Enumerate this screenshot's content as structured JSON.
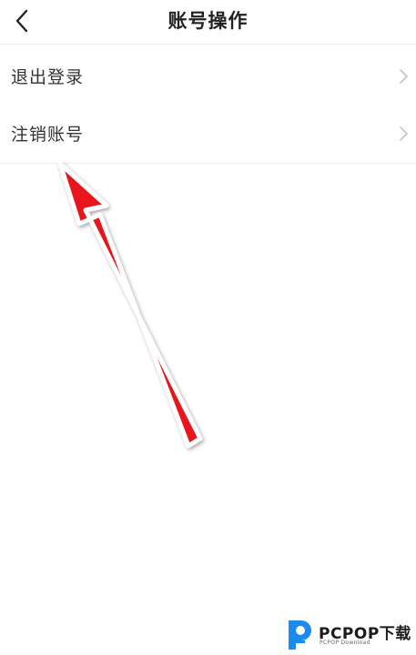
{
  "header": {
    "title": "账号操作",
    "back_icon": "chevron-left-icon"
  },
  "menu": {
    "items": [
      {
        "label": "退出登录",
        "icon": "chevron-right-icon"
      },
      {
        "label": "注销账号",
        "icon": "chevron-right-icon"
      }
    ]
  },
  "annotation": {
    "type": "red-arrow",
    "color": "#e8141b",
    "points_to": "注销账号"
  },
  "watermark": {
    "brand": "PCPOP下载",
    "subtitle": "PCPOP Download",
    "logo_color": "#1a8cf0"
  }
}
